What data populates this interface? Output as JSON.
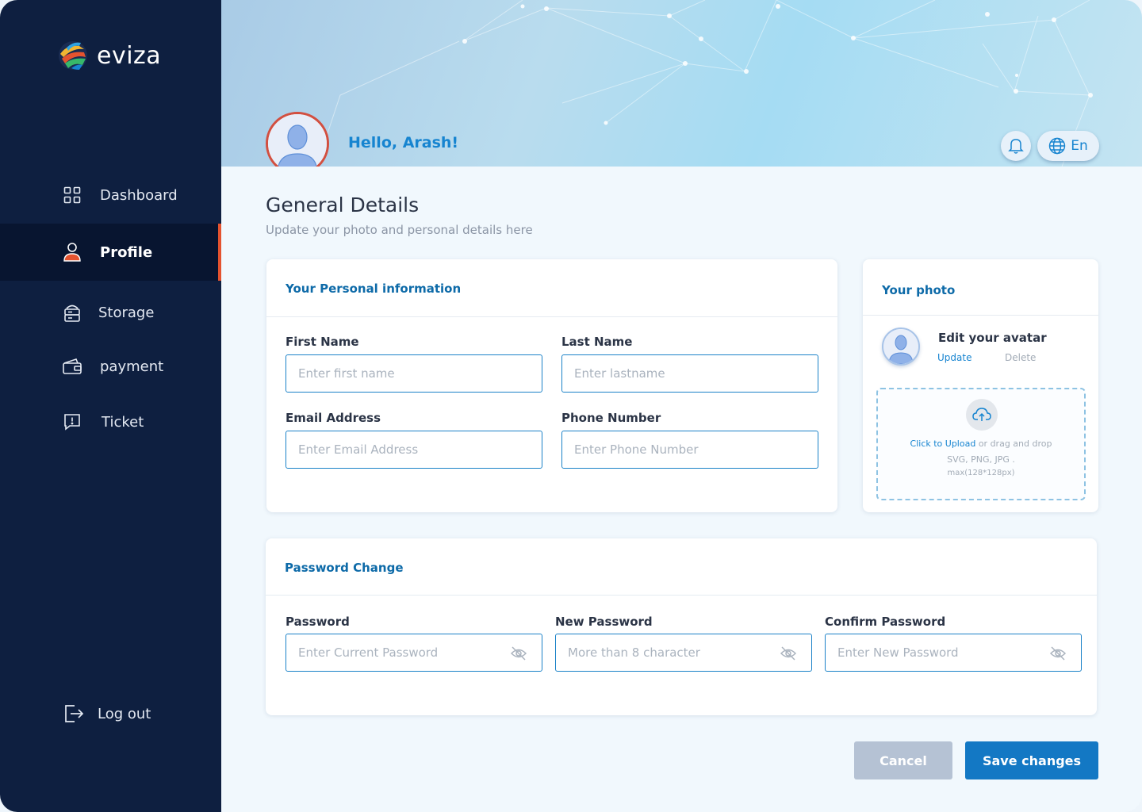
{
  "brand": {
    "name": "eviza"
  },
  "sidebar": {
    "items": [
      {
        "label": "Dashboard",
        "icon": "grid-icon"
      },
      {
        "label": "Profile",
        "icon": "user-icon",
        "active": true
      },
      {
        "label": "Storage",
        "icon": "storage-icon"
      },
      {
        "label": "payment",
        "icon": "wallet-icon"
      },
      {
        "label": "Ticket",
        "icon": "ticket-icon"
      }
    ],
    "logout_label": "Log out"
  },
  "header": {
    "greeting": "Hello, Arash!",
    "language": "En"
  },
  "page": {
    "title": "General Details",
    "subtitle": "Update your photo and personal details here"
  },
  "personal": {
    "title": "Your Personal information",
    "first_name": {
      "label": "First Name",
      "placeholder": "Enter first name"
    },
    "last_name": {
      "label": "Last Name",
      "placeholder": "Enter lastname"
    },
    "email": {
      "label": "Email Address",
      "placeholder": "Enter Email Address"
    },
    "phone": {
      "label": "Phone Number",
      "placeholder": "Enter Phone Number"
    }
  },
  "photo": {
    "title": "Your photo",
    "edit_label": "Edit your avatar",
    "update_label": "Update",
    "delete_label": "Delete",
    "upload_link": "Click to Upload",
    "upload_rest": " or drag and drop",
    "formats": "SVG, PNG, JPG .",
    "max_size": "max(128*128px)"
  },
  "password": {
    "title": "Password Change",
    "current": {
      "label": "Password",
      "placeholder": "Enter Current Password"
    },
    "new": {
      "label": "New Password",
      "placeholder": "More than 8 character"
    },
    "confirm": {
      "label": "Confirm Password",
      "placeholder": "Enter New Password"
    }
  },
  "actions": {
    "cancel_label": "Cancel",
    "save_label": "Save changes"
  },
  "colors": {
    "sidebar": "#0e1f40",
    "accent": "#1378c4",
    "active_marker": "#e4532f",
    "heading_blue": "#0d6aa8"
  }
}
